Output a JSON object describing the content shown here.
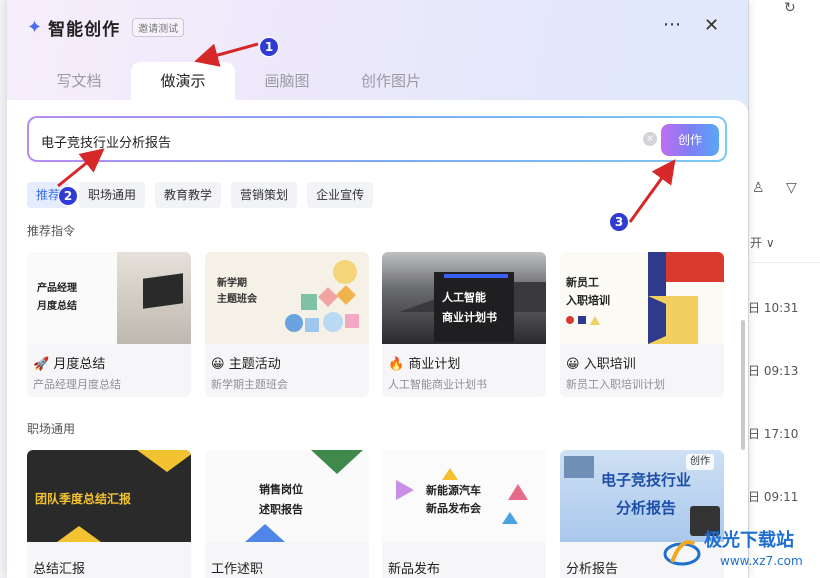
{
  "app": {
    "title": "智能创作",
    "badge": "邀请测试",
    "more": "⋯",
    "close": "✕",
    "sparkle": "✦"
  },
  "tabs": [
    {
      "label": "写文档"
    },
    {
      "label": "做演示"
    },
    {
      "label": "画脑图"
    },
    {
      "label": "创作图片"
    }
  ],
  "search": {
    "value": "电子竞技行业分析报告",
    "create_label": "创作",
    "clear": "×"
  },
  "chips": [
    {
      "label": "推荐"
    },
    {
      "label": "职场通用"
    },
    {
      "label": "教育教学"
    },
    {
      "label": "营销策划"
    },
    {
      "label": "企业宣传"
    }
  ],
  "section1": {
    "title": "推荐指令"
  },
  "section2": {
    "title": "职场通用"
  },
  "cards1": [
    {
      "emoji": "🚀",
      "title": "月度总结",
      "subtitle": "产品经理月度总结",
      "thumb_lines": [
        "产品经理",
        "月度总结"
      ]
    },
    {
      "emoji": "😀",
      "title": "主题活动",
      "subtitle": "新学期主题班会",
      "thumb_lines": [
        "新学期",
        "主题班会"
      ]
    },
    {
      "emoji": "🔥",
      "title": "商业计划",
      "subtitle": "人工智能商业计划书",
      "thumb_lines": [
        "人工智能",
        "商业计划书"
      ]
    },
    {
      "emoji": "😀",
      "title": "入职培训",
      "subtitle": "新员工入职培训计划",
      "thumb_lines": [
        "新员工",
        "入职培训"
      ]
    }
  ],
  "cards2": [
    {
      "title": "总结汇报",
      "thumb_text": "团队季度总结汇报"
    },
    {
      "title": "工作述职",
      "thumb_lines": [
        "销售岗位",
        "述职报告"
      ]
    },
    {
      "title": "新品发布",
      "thumb_lines": [
        "新能源汽车",
        "新品发布会"
      ]
    },
    {
      "title": "分析报告",
      "thumb_lines": [
        "电子竞技行业",
        "分析报告"
      ],
      "badge": "创作"
    }
  ],
  "annotations": [
    "1",
    "2",
    "3"
  ],
  "background": {
    "times": [
      "日 10:31",
      "日 09:13",
      "日 17:10",
      "日 09:11"
    ],
    "dropdown": "开 ∨",
    "person_icon": "♙",
    "filter_icon": "▽",
    "sync_icon": "↻"
  },
  "watermark": {
    "name": "极光下载站",
    "url": "www.xz7.com"
  },
  "colors": {
    "accent": "#3a6ff0",
    "create_gradient": [
      "#c16ff0",
      "#59a8f5"
    ],
    "annotation": "#2f3bd2",
    "arrow": "#d62828"
  }
}
